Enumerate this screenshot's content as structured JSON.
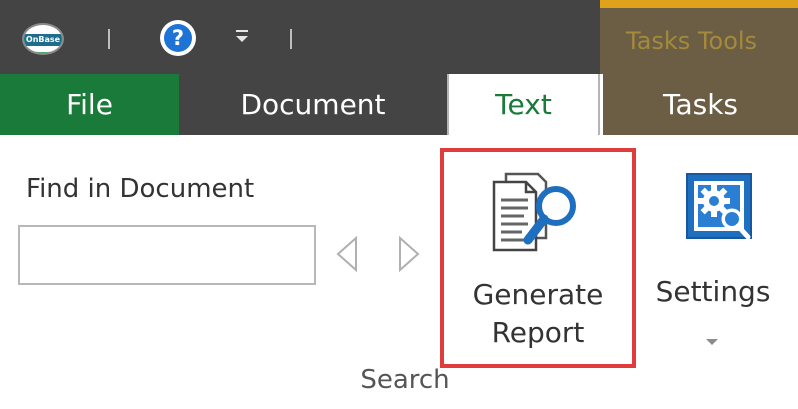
{
  "app": {
    "logo_text": "OnBase"
  },
  "quick_access": {
    "help_icon": "help-icon",
    "help_glyph": "?",
    "customize_icon": "customize-dropdown-icon"
  },
  "contextual_group": {
    "title": "Tasks Tools",
    "accent_color": "#e0a21a",
    "background_color": "#6b5e45"
  },
  "tabs": [
    {
      "label": "File",
      "color": "#1a7a3a"
    },
    {
      "label": "Document"
    },
    {
      "label": "Text",
      "active": true
    },
    {
      "label": "Tasks"
    }
  ],
  "search_group": {
    "find_label": "Find in Document",
    "find_value": "",
    "prev_icon": "previous-arrow-icon",
    "next_icon": "next-arrow-icon",
    "generate_report_label": "Generate Report",
    "generate_report_icon": "document-magnifier-icon",
    "highlight_color": "#e03c3c",
    "settings_label": "Settings",
    "settings_icon": "gear-magnifier-icon",
    "group_label": "Search"
  }
}
